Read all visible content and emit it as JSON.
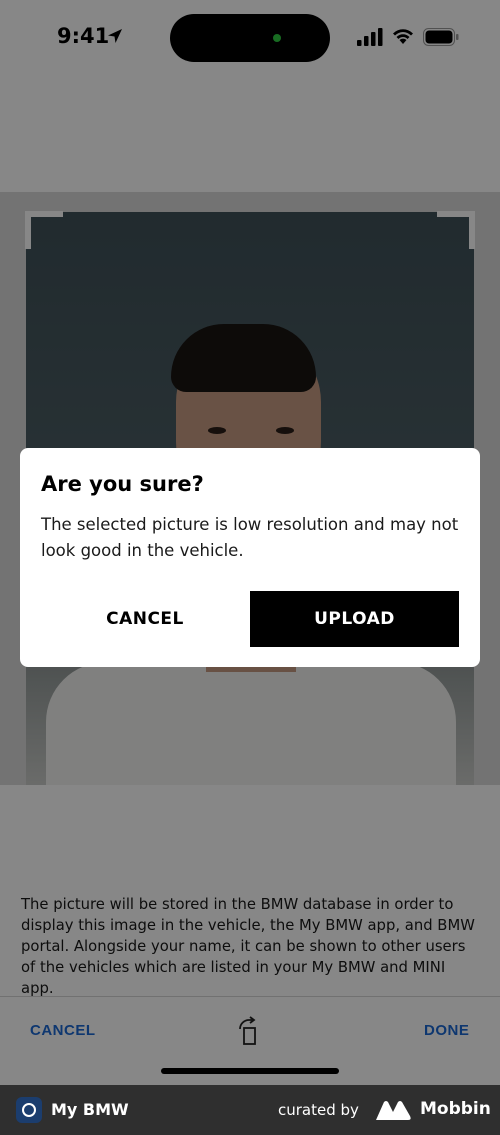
{
  "status_bar": {
    "time": "9:41"
  },
  "dialog": {
    "title": "Are you sure?",
    "message": "The selected picture is low resolution and may not look good in the vehicle.",
    "cancel_label": "CANCEL",
    "upload_label": "UPLOAD"
  },
  "disclaimer": "The picture will be stored in the BMW database in order to display this image in the vehicle, the My BMW app, and BMW portal. Alongside your name, it can be shown to other users of the vehicles which are listed in your My BMW and MINI app.",
  "toolbar": {
    "cancel_label": "CANCEL",
    "rotate_icon": "rotate-icon",
    "done_label": "DONE"
  },
  "footer": {
    "app_name": "My BMW",
    "curated_by": "curated by",
    "brand": "Mobbin"
  },
  "colors": {
    "accent": "#1c69d4",
    "overlay": "#000000",
    "footer_bg": "#2f2f2f"
  }
}
